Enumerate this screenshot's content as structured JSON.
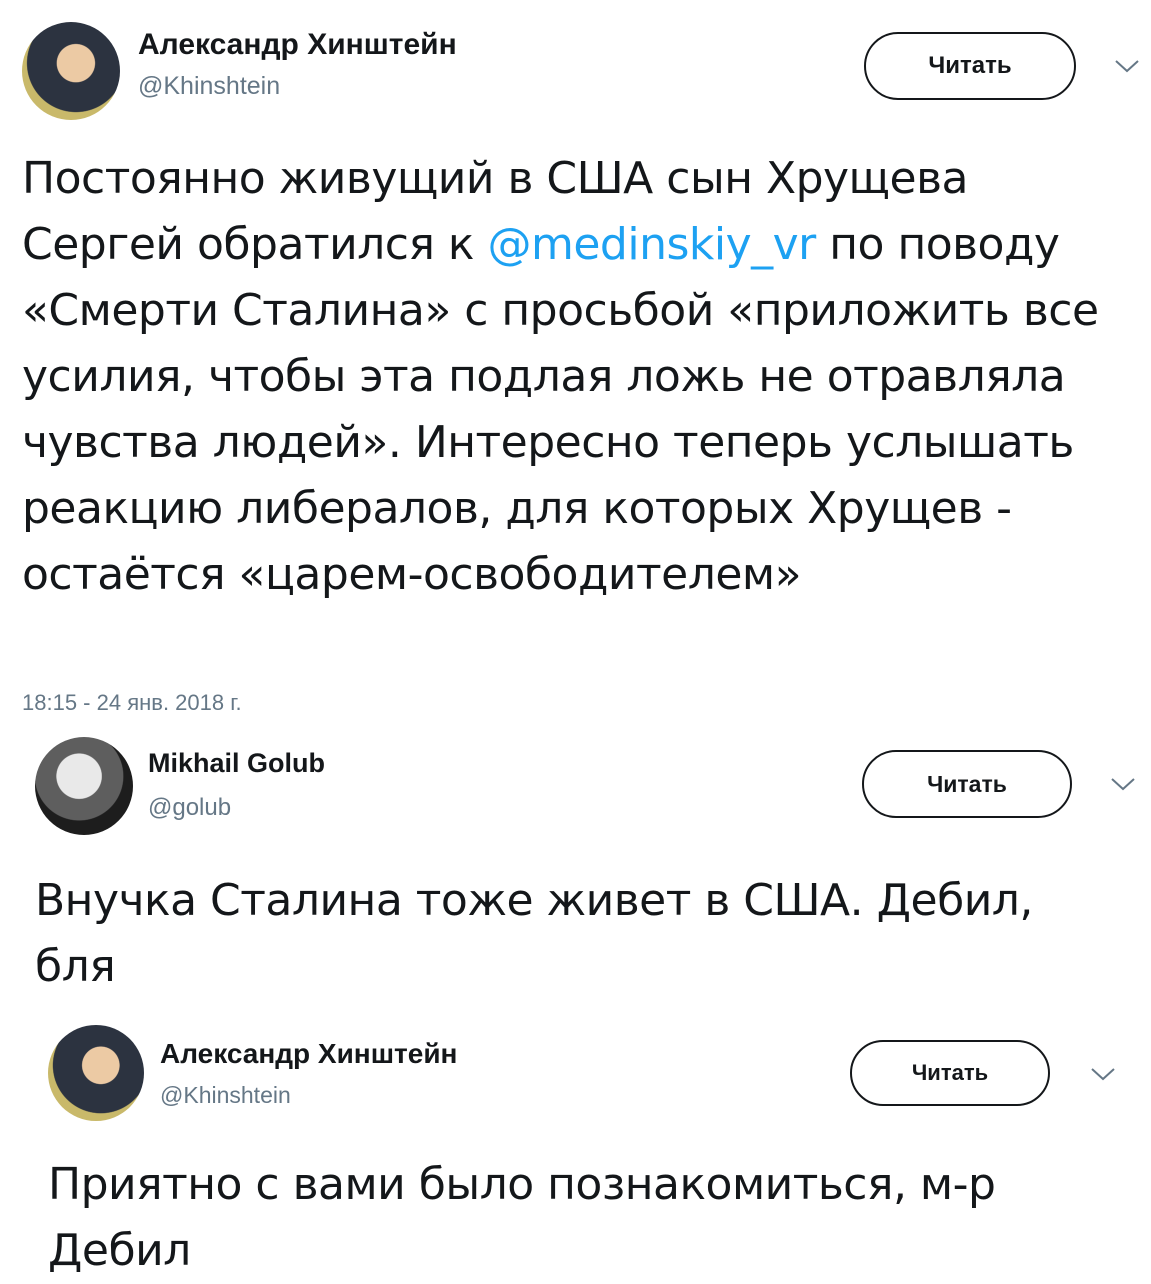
{
  "tweets": [
    {
      "author_name": "Александр Хинштейн",
      "author_handle": "@Khinshtein",
      "follow_label": "Читать",
      "text_before": "Постоянно живущий в США сын Хрущева Сергей обратился к ",
      "mention": "@medinskiy_vr",
      "text_after": " по поводу «Смерти Сталина» с просьбой «приложить все усилия, чтобы эта подлая ложь не отравляла чувства людей». Интересно теперь услышать реакцию либералов, для которых Хрущев - остаётся «царем-освободителем»",
      "timestamp": "18:15 - 24 янв. 2018 г."
    },
    {
      "author_name": "Mikhail Golub",
      "author_handle": "@golub",
      "follow_label": "Читать",
      "text": "Внучка Сталина тоже живет в США. Дебил, бля"
    },
    {
      "author_name": "Александр Хинштейн",
      "author_handle": "@Khinshtein",
      "follow_label": "Читать",
      "text": "Приятно с вами было познакомиться, м-р Дебил"
    }
  ],
  "colors": {
    "text": "#14171a",
    "secondary": "#657786",
    "link": "#1da1f2"
  },
  "icons": [
    "chevron-down-icon"
  ]
}
